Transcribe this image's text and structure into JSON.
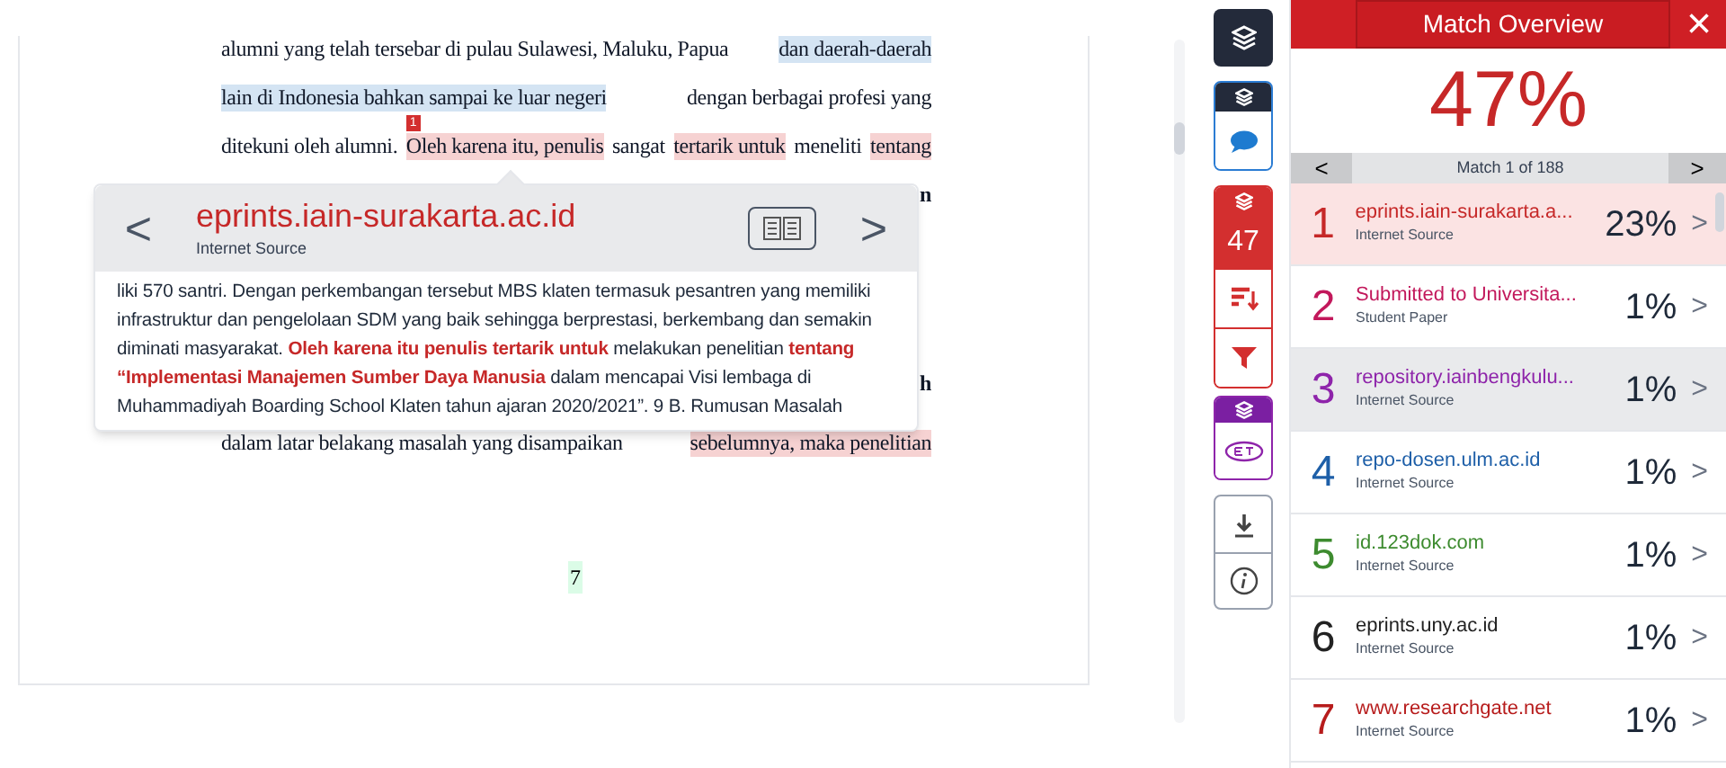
{
  "document": {
    "lines": [
      {
        "segments": [
          {
            "text": "alumni yang telah tersebar di pulau Sulawesi, Maluku, Papua"
          },
          {
            "text": "dan daerah-daerah",
            "color": "#d4e4f3"
          }
        ]
      },
      {
        "segments": [
          {
            "text": "lain di Indonesia bahkan sampai ke luar negeri",
            "color": "#d4e4f3"
          },
          {
            "text": "dengan berbagai profesi yang"
          }
        ]
      },
      {
        "segments": [
          {
            "text": "ditekuni oleh alumni."
          },
          {
            "text": "Oleh karena itu, penulis",
            "color": "#f6d2d2",
            "marker": "1"
          },
          {
            "text": "sangat"
          },
          {
            "text": "tertarik untuk",
            "color": "#f6d2d2"
          },
          {
            "text": "meneliti"
          },
          {
            "text": "tentang",
            "color": "#f6d2d2"
          }
        ]
      }
    ],
    "covered_line_ends": [
      "n",
      "h"
    ],
    "last_line": {
      "segments": [
        {
          "text": "dalam latar belakang masalah yang disampaikan"
        },
        {
          "text": "sebelumnya, maka penelitian",
          "color": "#f6d2d2"
        }
      ]
    },
    "page_number": "7"
  },
  "popover": {
    "title": "eprints.iain-surakarta.ac.id",
    "subtitle": "Internet Source",
    "prev": "<",
    "next": ">",
    "excerpt": "liki 570 santri. Dengan perkembangan tersebut MBS klaten termasuk pesantren yang memiliki infrastruktur dan pengelolaan SDM yang baik sehingga berprestasi, berkembang dan semakin diminati masyarakat. **Oleh karena itu penulis tertarik untuk** melakukan penelitian **tentang “Implementasi Manajemen Sumber Daya Manusia** dalam mencapai Visi lembaga di Muhammadiyah Boarding School Klaten tahun ajaran 2020/2021”. 9 B. Rumusan Masalah"
  },
  "toolbar": {
    "similarity_count": "47"
  },
  "panel": {
    "title": "Match Overview",
    "close": "×",
    "score": "47%",
    "nav": {
      "prev": "<",
      "label": "Match 1 of 188",
      "next": ">"
    },
    "matches": [
      {
        "rank": "1",
        "source": "eprints.iain-surakarta.a...",
        "type": "Internet Source",
        "percent": "23%",
        "color": "#c62828",
        "selected": true
      },
      {
        "rank": "2",
        "source": "Submitted to Universita...",
        "type": "Student Paper",
        "percent": "1%",
        "color": "#c2185b",
        "selected": false
      },
      {
        "rank": "3",
        "source": "repository.iainbengkulu...",
        "type": "Internet Source",
        "percent": "1%",
        "color": "#8e24aa",
        "selected": false
      },
      {
        "rank": "4",
        "source": "repo-dosen.ulm.ac.id",
        "type": "Internet Source",
        "percent": "1%",
        "color": "#1e5fa8",
        "selected": false
      },
      {
        "rank": "5",
        "source": "id.123dok.com",
        "type": "Internet Source",
        "percent": "1%",
        "color": "#3d8b2f",
        "selected": false
      },
      {
        "rank": "6",
        "source": "eprints.uny.ac.id",
        "type": "Internet Source",
        "percent": "1%",
        "color": "#222222",
        "selected": false
      },
      {
        "rank": "7",
        "source": "www.researchgate.net",
        "type": "Internet Source",
        "percent": "1%",
        "color": "#b71c1c",
        "selected": false
      }
    ],
    "chevron": ">"
  }
}
